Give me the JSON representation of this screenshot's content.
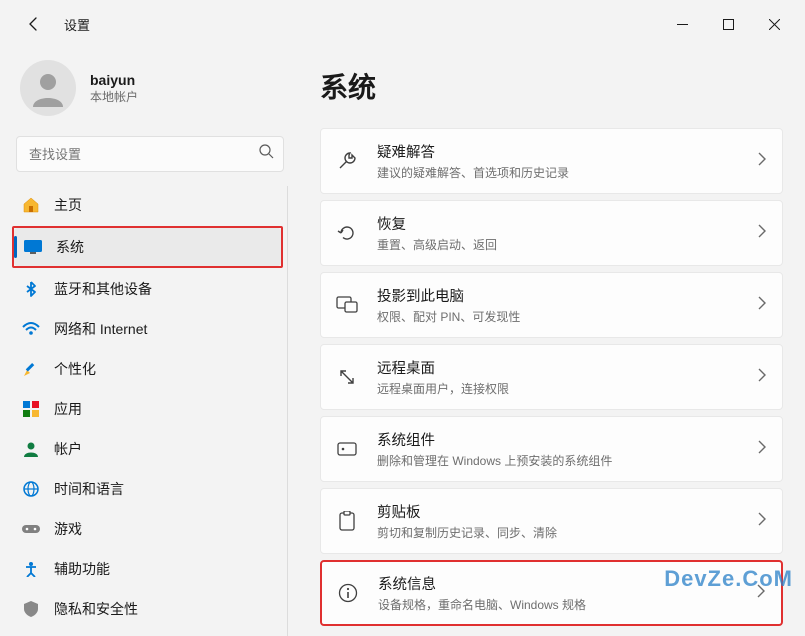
{
  "window": {
    "title": "设置"
  },
  "user": {
    "name": "baiyun",
    "subtitle": "本地帐户"
  },
  "search": {
    "placeholder": "查找设置"
  },
  "sidebar": {
    "items": [
      {
        "label": "主页"
      },
      {
        "label": "系统"
      },
      {
        "label": "蓝牙和其他设备"
      },
      {
        "label": "网络和 Internet"
      },
      {
        "label": "个性化"
      },
      {
        "label": "应用"
      },
      {
        "label": "帐户"
      },
      {
        "label": "时间和语言"
      },
      {
        "label": "游戏"
      },
      {
        "label": "辅助功能"
      },
      {
        "label": "隐私和安全性"
      }
    ]
  },
  "main": {
    "heading": "系统",
    "cards": [
      {
        "title": "疑难解答",
        "subtitle": "建议的疑难解答、首选项和历史记录"
      },
      {
        "title": "恢复",
        "subtitle": "重置、高级启动、返回"
      },
      {
        "title": "投影到此电脑",
        "subtitle": "权限、配对 PIN、可发现性"
      },
      {
        "title": "远程桌面",
        "subtitle": "远程桌面用户，连接权限"
      },
      {
        "title": "系统组件",
        "subtitle": "删除和管理在 Windows 上预安装的系统组件"
      },
      {
        "title": "剪贴板",
        "subtitle": "剪切和复制历史记录、同步、清除"
      },
      {
        "title": "系统信息",
        "subtitle": "设备规格，重命名电脑、Windows 规格"
      }
    ]
  },
  "watermark": "DevZe.CoM"
}
